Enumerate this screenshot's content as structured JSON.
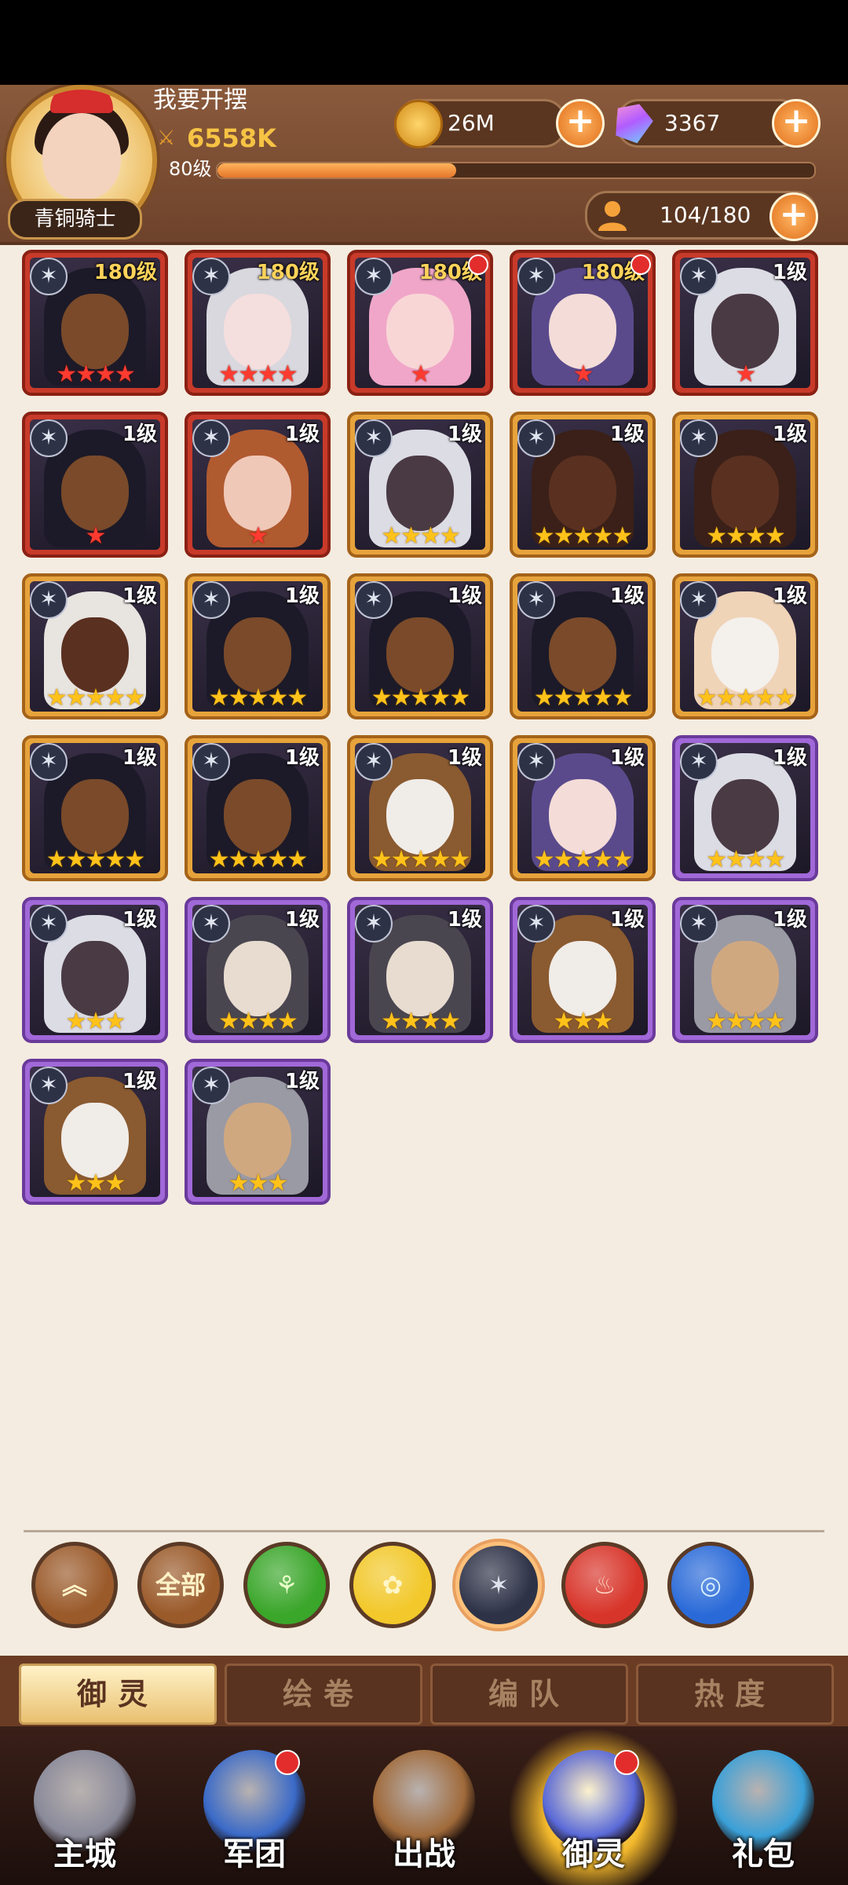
{
  "player": {
    "name": "我要开摆",
    "power": "6558K",
    "level": "80级",
    "rank": "青铜骑士",
    "xp_progress": 0.4
  },
  "resources": {
    "coins": "26M",
    "gems": "3367",
    "capacity": "104/180"
  },
  "cards": [
    {
      "level": "180级",
      "frame": "red",
      "stars": "★★★★",
      "star_color": "red",
      "dot": false,
      "skin": "#7a4a2a",
      "hair": "#1c1a28"
    },
    {
      "level": "180级",
      "frame": "red",
      "stars": "★★★★",
      "star_color": "red",
      "dot": false,
      "skin": "#f5dede",
      "hair": "#d8d8de"
    },
    {
      "level": "180级",
      "frame": "red",
      "stars": "★",
      "star_color": "red",
      "dot": true,
      "skin": "#f8d6d6",
      "hair": "#f0a6c8"
    },
    {
      "level": "180级",
      "frame": "red",
      "stars": "★",
      "star_color": "red",
      "dot": true,
      "skin": "#f4dcd8",
      "hair": "#5a4a8c"
    },
    {
      "level": "1级",
      "frame": "red",
      "stars": "★",
      "star_color": "red",
      "dot": false,
      "skin": "#4a3a44",
      "hair": "#dcdce4"
    },
    {
      "level": "1级",
      "frame": "red",
      "stars": "★",
      "star_color": "red",
      "dot": false,
      "skin": "#7a4a2a",
      "hair": "#1c1a28"
    },
    {
      "level": "1级",
      "frame": "red",
      "stars": "★",
      "star_color": "red",
      "dot": false,
      "skin": "#f0c8b8",
      "hair": "#b05a30"
    },
    {
      "level": "1级",
      "frame": "orange",
      "stars": "★★★★",
      "star_color": "gold",
      "dot": false,
      "skin": "#4a3a44",
      "hair": "#dcdce4"
    },
    {
      "level": "1级",
      "frame": "orange",
      "stars": "★★★★★",
      "star_color": "gold",
      "dot": false,
      "skin": "#5a3020",
      "hair": "#3a2018"
    },
    {
      "level": "1级",
      "frame": "orange",
      "stars": "★★★★",
      "star_color": "gold",
      "dot": false,
      "skin": "#5a3020",
      "hair": "#3a2018"
    },
    {
      "level": "1级",
      "frame": "orange",
      "stars": "★★★★★",
      "star_color": "gold",
      "dot": false,
      "skin": "#5a3020",
      "hair": "#e8e4e0"
    },
    {
      "level": "1级",
      "frame": "orange",
      "stars": "★★★★★",
      "star_color": "gold",
      "dot": false,
      "skin": "#7a4a2a",
      "hair": "#1c1a28"
    },
    {
      "level": "1级",
      "frame": "orange",
      "stars": "★★★★★",
      "star_color": "gold",
      "dot": false,
      "skin": "#7a4a2a",
      "hair": "#1c1a28"
    },
    {
      "level": "1级",
      "frame": "orange",
      "stars": "★★★★★",
      "star_color": "gold",
      "dot": false,
      "skin": "#7a4a2a",
      "hair": "#1c1a28"
    },
    {
      "level": "1级",
      "frame": "orange",
      "stars": "★★★★★",
      "star_color": "gold",
      "dot": false,
      "skin": "#f4f0ec",
      "hair": "#f0d4b8"
    },
    {
      "level": "1级",
      "frame": "orange",
      "stars": "★★★★★",
      "star_color": "gold",
      "dot": false,
      "skin": "#7a4a2a",
      "hair": "#1c1a28"
    },
    {
      "level": "1级",
      "frame": "orange",
      "stars": "★★★★★",
      "star_color": "gold",
      "dot": false,
      "skin": "#7a4a2a",
      "hair": "#1c1a28"
    },
    {
      "level": "1级",
      "frame": "orange",
      "stars": "★★★★★",
      "star_color": "gold",
      "dot": false,
      "skin": "#f0ece8",
      "hair": "#8a5a30"
    },
    {
      "level": "1级",
      "frame": "orange",
      "stars": "★★★★★",
      "star_color": "gold",
      "dot": false,
      "skin": "#f4dcd8",
      "hair": "#5a4a8c"
    },
    {
      "level": "1级",
      "frame": "purple",
      "stars": "★★★★",
      "star_color": "gold",
      "dot": false,
      "skin": "#4a3a44",
      "hair": "#dcdce4"
    },
    {
      "level": "1级",
      "frame": "purple",
      "stars": "★★★",
      "star_color": "gold",
      "dot": false,
      "skin": "#4a3a44",
      "hair": "#dcdce4"
    },
    {
      "level": "1级",
      "frame": "purple",
      "stars": "★★★★",
      "star_color": "gold",
      "dot": false,
      "skin": "#e8dcd0",
      "hair": "#4a4650"
    },
    {
      "level": "1级",
      "frame": "purple",
      "stars": "★★★★",
      "star_color": "gold",
      "dot": false,
      "skin": "#e8dcd0",
      "hair": "#4a4650"
    },
    {
      "level": "1级",
      "frame": "purple",
      "stars": "★★★",
      "star_color": "gold",
      "dot": false,
      "skin": "#f0ece8",
      "hair": "#8a5a30"
    },
    {
      "level": "1级",
      "frame": "purple",
      "stars": "★★★★",
      "star_color": "gold",
      "dot": false,
      "skin": "#d0a880",
      "hair": "#9a9aa4"
    },
    {
      "level": "1级",
      "frame": "purple",
      "stars": "★★★",
      "star_color": "gold",
      "dot": false,
      "skin": "#f0ece8",
      "hair": "#8a5a30"
    },
    {
      "level": "1级",
      "frame": "purple",
      "stars": "★★★",
      "star_color": "gold",
      "dot": false,
      "skin": "#d0a880",
      "hair": "#9a9aa4"
    }
  ],
  "filters": [
    {
      "name": "collapse-button",
      "label": "︽",
      "bg": "#9a5a2a",
      "color": "#fff3c8"
    },
    {
      "name": "filter-all-button",
      "label": "全部",
      "bg": "#9a5a2a",
      "color": "#fff3c8"
    },
    {
      "name": "filter-nature-button",
      "label": "⚘",
      "bg": "#3aa62a",
      "color": "#e8ffc8"
    },
    {
      "name": "filter-light-button",
      "label": "✿",
      "bg": "#f2c82a",
      "color": "#fff6c8"
    },
    {
      "name": "filter-dark-button",
      "label": "✶",
      "bg": "#2e3247",
      "color": "#dfe3ee"
    },
    {
      "name": "filter-fire-button",
      "label": "♨",
      "bg": "#d8352a",
      "color": "#ffd8c8"
    },
    {
      "name": "filter-water-button",
      "label": "◎",
      "bg": "#2a6ad8",
      "color": "#d8f0ff"
    }
  ],
  "tabs": [
    {
      "label": "御灵",
      "active": true
    },
    {
      "label": "绘卷",
      "active": false
    },
    {
      "label": "编队",
      "active": false
    },
    {
      "label": "热度",
      "active": false
    }
  ],
  "nav": [
    {
      "label": "主城",
      "icon": "castle-icon",
      "color": "#8a8a9a",
      "dot": false,
      "active": false
    },
    {
      "label": "军团",
      "icon": "guild-shield-icon",
      "color": "#3a6ac8",
      "dot": true,
      "active": false
    },
    {
      "label": "出战",
      "icon": "battle-gate-icon",
      "color": "#a06a3a",
      "dot": false,
      "active": false
    },
    {
      "label": "御灵",
      "icon": "spirit-crystal-icon",
      "color": "#5a6ad8",
      "dot": true,
      "active": true
    },
    {
      "label": "礼包",
      "icon": "gift-shop-icon",
      "color": "#3aa0d8",
      "dot": false,
      "active": false
    }
  ]
}
